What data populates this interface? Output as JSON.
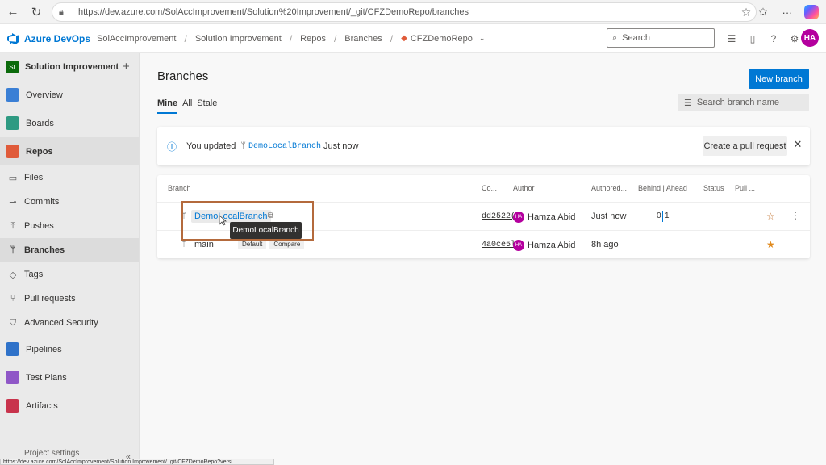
{
  "browser": {
    "url": "https://dev.azure.com/SolAccImprovement/Solution%20Improvement/_git/CFZDemoRepo/branches",
    "status_url": "https://dev.azure.com/SolAccImprovement/Solution Improvement/_git/CFZDemoRepo?versi"
  },
  "header": {
    "brand": "Azure DevOps",
    "breadcrumbs": [
      "SolAccImprovement",
      "Solution Improvement",
      "Repos",
      "Branches",
      "CFZDemoRepo"
    ],
    "search_placeholder": "Search",
    "avatar": "HA"
  },
  "sidebar": {
    "project_badge": "SI",
    "project": "Solution Improvement",
    "items": [
      {
        "label": "Overview",
        "color": "#3a7fd5"
      },
      {
        "label": "Boards",
        "color": "#2e9a82"
      },
      {
        "label": "Repos",
        "color": "#e05b3a"
      },
      {
        "label": "Files"
      },
      {
        "label": "Commits"
      },
      {
        "label": "Pushes"
      },
      {
        "label": "Branches"
      },
      {
        "label": "Tags"
      },
      {
        "label": "Pull requests"
      },
      {
        "label": "Advanced Security"
      },
      {
        "label": "Pipelines",
        "color": "#2f72c9"
      },
      {
        "label": "Test Plans",
        "color": "#8f57c7"
      },
      {
        "label": "Artifacts",
        "color": "#c8334c"
      }
    ],
    "project_settings": "Project settings"
  },
  "main": {
    "title": "Branches",
    "new_branch": "New branch",
    "pivots": [
      "Mine",
      "All",
      "Stale"
    ],
    "filter_placeholder": "Search branch name",
    "banner": {
      "prefix": "You updated",
      "branch": "DemoLocalBranch",
      "suffix": "Just now",
      "action": "Create a pull request"
    },
    "columns": [
      "Branch",
      "Co...",
      "Author",
      "Authored...",
      "Behind | Ahead",
      "Status",
      "Pull ..."
    ],
    "rows": [
      {
        "branch": "DemoLocalBranch",
        "commit": "dd2522(",
        "author_initials": "HA",
        "author": "Hamza Abid",
        "authored": "Just now",
        "behind": "0",
        "ahead": "1",
        "tags": []
      },
      {
        "branch": "main",
        "commit": "4a0ce5l",
        "author_initials": "HA",
        "author": "Hamza Abid",
        "authored": "8h ago",
        "behind": "",
        "ahead": "",
        "tags": [
          "Default",
          "Compare"
        ]
      }
    ],
    "tooltip": "DemoLocalBranch"
  }
}
